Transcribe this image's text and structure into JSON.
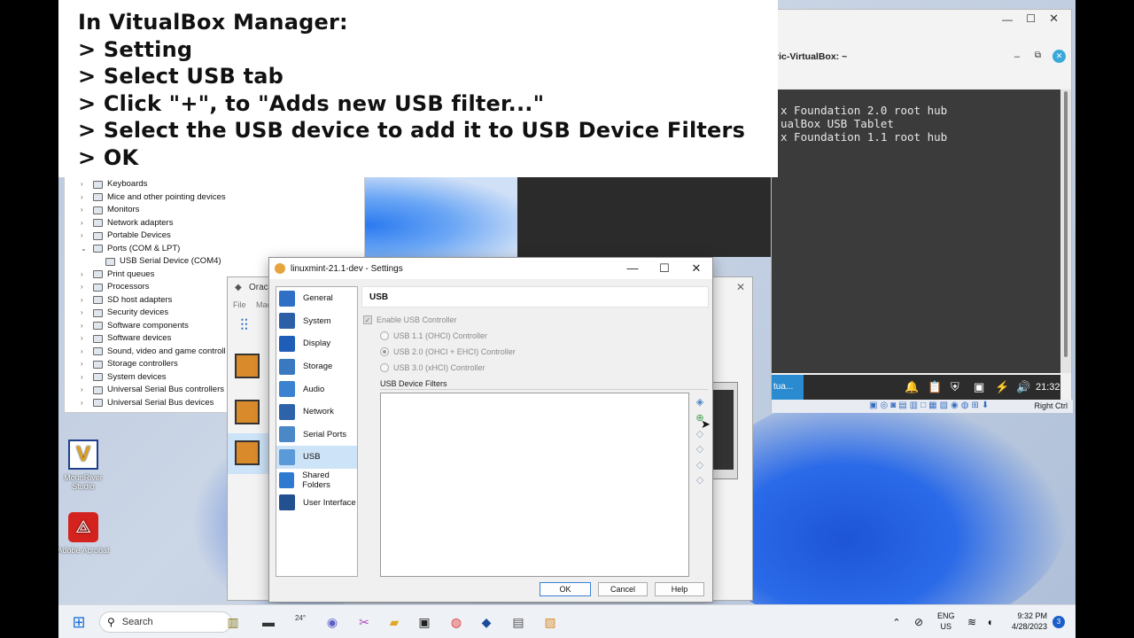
{
  "instructions": {
    "lines": [
      "In VitualBox Manager:",
      "> Setting",
      "> Select USB tab",
      "> Click \"+\", to \"Adds new USB filter...\"",
      "> Select the USB device to add it to USB Device Filters",
      "> OK"
    ]
  },
  "device_manager": {
    "items": [
      {
        "label": "Keyboards",
        "arrow": "›",
        "child": false
      },
      {
        "label": "Mice and other pointing devices",
        "arrow": "›",
        "child": false
      },
      {
        "label": "Monitors",
        "arrow": "›",
        "child": false
      },
      {
        "label": "Network adapters",
        "arrow": "›",
        "child": false
      },
      {
        "label": "Portable Devices",
        "arrow": "›",
        "child": false
      },
      {
        "label": "Ports (COM & LPT)",
        "arrow": "⌄",
        "child": false
      },
      {
        "label": "USB Serial Device (COM4)",
        "arrow": "",
        "child": true
      },
      {
        "label": "Print queues",
        "arrow": "›",
        "child": false
      },
      {
        "label": "Processors",
        "arrow": "›",
        "child": false
      },
      {
        "label": "SD host adapters",
        "arrow": "›",
        "child": false
      },
      {
        "label": "Security devices",
        "arrow": "›",
        "child": false
      },
      {
        "label": "Software components",
        "arrow": "›",
        "child": false
      },
      {
        "label": "Software devices",
        "arrow": "›",
        "child": false
      },
      {
        "label": "Sound, video and game controll",
        "arrow": "›",
        "child": false
      },
      {
        "label": "Storage controllers",
        "arrow": "›",
        "child": false
      },
      {
        "label": "System devices",
        "arrow": "›",
        "child": false
      },
      {
        "label": "Universal Serial Bus controllers",
        "arrow": "›",
        "child": false
      },
      {
        "label": "Universal Serial Bus devices",
        "arrow": "›",
        "child": false
      }
    ]
  },
  "terminal": {
    "title": "ric-VirtualBox: ~",
    "lines": [
      "x Foundation 2.0 root hub",
      "ualBox USB Tablet",
      "x Foundation 1.1 root hub"
    ],
    "panel_label": "tua...",
    "clock": "21:32",
    "status_right": "Right Ctrl"
  },
  "vbox_manager": {
    "title": "Orac",
    "menu": [
      "File",
      "Mac"
    ]
  },
  "settings": {
    "title": "linuxmint-21.1-dev - Settings",
    "sidebar": [
      {
        "label": "General",
        "icon": "general-icon",
        "color": "#2f6fc6"
      },
      {
        "label": "System",
        "icon": "system-icon",
        "color": "#2b5fa8"
      },
      {
        "label": "Display",
        "icon": "display-icon",
        "color": "#1e5db8"
      },
      {
        "label": "Storage",
        "icon": "storage-icon",
        "color": "#3a78c0"
      },
      {
        "label": "Audio",
        "icon": "audio-icon",
        "color": "#3b82d0"
      },
      {
        "label": "Network",
        "icon": "network-icon",
        "color": "#2d63a8"
      },
      {
        "label": "Serial Ports",
        "icon": "serial-ports-icon",
        "color": "#4a88c8"
      },
      {
        "label": "USB",
        "icon": "usb-icon",
        "color": "#5a9ad8",
        "selected": true
      },
      {
        "label": "Shared Folders",
        "icon": "shared-folders-icon",
        "color": "#2e7ad0"
      },
      {
        "label": "User Interface",
        "icon": "user-interface-icon",
        "color": "#23508f"
      }
    ],
    "panel_title": "USB",
    "enable_usb": "Enable USB Controller",
    "usb11": "USB 1.1 (OHCI) Controller",
    "usb20": "USB 2.0 (OHCI + EHCI) Controller",
    "usb30": "USB 3.0 (xHCI) Controller",
    "filters_label": "USB Device Filters",
    "ok": "OK",
    "cancel": "Cancel",
    "help": "Help"
  },
  "desktop": {
    "icons": [
      {
        "label": "MounRiver Studio"
      },
      {
        "label": "Adobe Acrobat"
      }
    ]
  },
  "taskbar": {
    "search": "Search",
    "weather": "24°",
    "lang1": "ENG",
    "lang2": "US",
    "time": "9:32 PM",
    "date": "4/28/2023",
    "notifications": "3"
  }
}
